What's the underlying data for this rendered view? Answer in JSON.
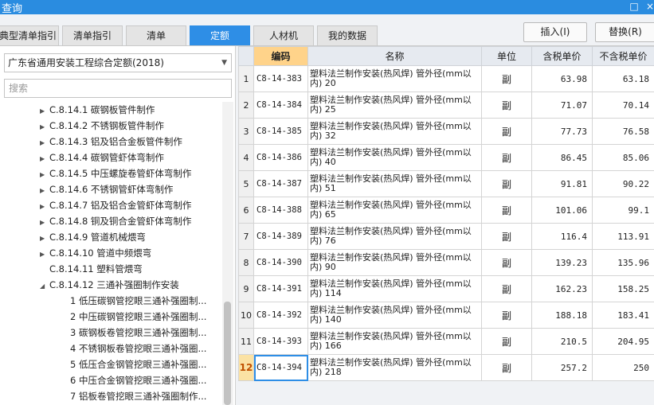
{
  "window": {
    "title": "查询",
    "restore_glyph": "□",
    "close_glyph": "×"
  },
  "tabs": [
    {
      "label": "典型清单指引"
    },
    {
      "label": "清单指引"
    },
    {
      "label": "清单"
    },
    {
      "label": "定额"
    },
    {
      "label": "人材机"
    },
    {
      "label": "我的数据"
    }
  ],
  "active_tab": "定额",
  "actions": {
    "insert": "插入(I)",
    "replace": "替换(R)"
  },
  "left": {
    "quota_library": "广东省通用安装工程综合定额(2018)",
    "search_placeholder": "搜索",
    "tree": [
      {
        "label": "C.8.14.1 碳钢板管件制作",
        "expandable": true
      },
      {
        "label": "C.8.14.2 不锈钢板管件制作",
        "expandable": true
      },
      {
        "label": "C.8.14.3 铝及铝合金板管件制作",
        "expandable": true
      },
      {
        "label": "C.8.14.4 碳钢管虾体弯制作",
        "expandable": true
      },
      {
        "label": "C.8.14.5 中压螺旋卷管虾体弯制作",
        "expandable": true
      },
      {
        "label": "C.8.14.6 不锈钢管虾体弯制作",
        "expandable": true
      },
      {
        "label": "C.8.14.7 铝及铝合金管虾体弯制作",
        "expandable": true
      },
      {
        "label": "C.8.14.8 铜及铜合金管虾体弯制作",
        "expandable": true
      },
      {
        "label": "C.8.14.9 管道机械煨弯",
        "expandable": true
      },
      {
        "label": "C.8.14.10 管道中频煨弯",
        "expandable": true
      },
      {
        "label": "C.8.14.11 塑料管煨弯",
        "expandable": false
      },
      {
        "label": "C.8.14.12 三通补强圈制作安装",
        "expandable": true,
        "expanded": true
      },
      {
        "label": "1 低压碳钢管挖眼三通补强圈制...",
        "child": true
      },
      {
        "label": "2 中压碳钢管挖眼三通补强圈制...",
        "child": true
      },
      {
        "label": "3 碳钢板卷管挖眼三通补强圈制...",
        "child": true
      },
      {
        "label": "4 不锈钢板卷管挖眼三通补强圈...",
        "child": true
      },
      {
        "label": "5 低压合金钢管挖眼三通补强圈...",
        "child": true
      },
      {
        "label": "6 中压合金钢管挖眼三通补强圈...",
        "child": true
      },
      {
        "label": "7 铝板卷管挖眼三通补强圈制作...",
        "child": true
      }
    ],
    "scrollbar": {
      "thumb_start_fraction": 0.66,
      "thumb_size_fraction": 0.34
    }
  },
  "grid": {
    "columns": [
      "编码",
      "名称",
      "单位",
      "含税单价",
      "不含税单价"
    ],
    "sorted_column": "编码",
    "selected_row": 12,
    "rows": [
      {
        "idx": "1",
        "code": "C8-14-383",
        "name": "塑料法兰制作安装(热风焊) 管外径(mm以内) 20",
        "unit": "副",
        "price_tax": "63.98",
        "price_notax": "63.18"
      },
      {
        "idx": "2",
        "code": "C8-14-384",
        "name": "塑料法兰制作安装(热风焊) 管外径(mm以内) 25",
        "unit": "副",
        "price_tax": "71.07",
        "price_notax": "70.14"
      },
      {
        "idx": "3",
        "code": "C8-14-385",
        "name": "塑料法兰制作安装(热风焊) 管外径(mm以内) 32",
        "unit": "副",
        "price_tax": "77.73",
        "price_notax": "76.58"
      },
      {
        "idx": "4",
        "code": "C8-14-386",
        "name": "塑料法兰制作安装(热风焊) 管外径(mm以内) 40",
        "unit": "副",
        "price_tax": "86.45",
        "price_notax": "85.06"
      },
      {
        "idx": "5",
        "code": "C8-14-387",
        "name": "塑料法兰制作安装(热风焊) 管外径(mm以内) 51",
        "unit": "副",
        "price_tax": "91.81",
        "price_notax": "90.22"
      },
      {
        "idx": "6",
        "code": "C8-14-388",
        "name": "塑料法兰制作安装(热风焊) 管外径(mm以内) 65",
        "unit": "副",
        "price_tax": "101.06",
        "price_notax": "99.1"
      },
      {
        "idx": "7",
        "code": "C8-14-389",
        "name": "塑料法兰制作安装(热风焊) 管外径(mm以内) 76",
        "unit": "副",
        "price_tax": "116.4",
        "price_notax": "113.91"
      },
      {
        "idx": "8",
        "code": "C8-14-390",
        "name": "塑料法兰制作安装(热风焊) 管外径(mm以内) 90",
        "unit": "副",
        "price_tax": "139.23",
        "price_notax": "135.96"
      },
      {
        "idx": "9",
        "code": "C8-14-391",
        "name": "塑料法兰制作安装(热风焊) 管外径(mm以内) 114",
        "unit": "副",
        "price_tax": "162.23",
        "price_notax": "158.25"
      },
      {
        "idx": "10",
        "code": "C8-14-392",
        "name": "塑料法兰制作安装(热风焊) 管外径(mm以内) 140",
        "unit": "副",
        "price_tax": "188.18",
        "price_notax": "183.41"
      },
      {
        "idx": "11",
        "code": "C8-14-393",
        "name": "塑料法兰制作安装(热风焊) 管外径(mm以内) 166",
        "unit": "副",
        "price_tax": "210.5",
        "price_notax": "204.95"
      },
      {
        "idx": "12",
        "code": "C8-14-394",
        "name": "塑料法兰制作安装(热风焊) 管外径(mm以内) 218",
        "unit": "副",
        "price_tax": "257.2",
        "price_notax": "250"
      }
    ]
  },
  "colors": {
    "accent": "#2e8ee6",
    "titlebar": "#2a8ce0",
    "sorted_header": "#ffd38a",
    "selected_index": "#fbe2a4"
  }
}
